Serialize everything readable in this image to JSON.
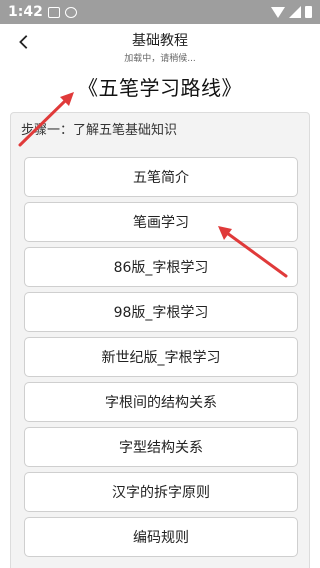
{
  "status_bar": {
    "time": "1:42",
    "icons": [
      "notification-icon",
      "sync-icon",
      "wifi-icon",
      "signal-icon",
      "battery-icon"
    ]
  },
  "nav": {
    "title": "基础教程",
    "subtitle": "加载中，请稍候..."
  },
  "main_title": "《五笔学习路线》",
  "step": {
    "label": "步骤一：了解五笔基础知识"
  },
  "topics": [
    "五笔简介",
    "笔画学习",
    "86版_字根学习",
    "98版_字根学习",
    "新世纪版_字根学习",
    "字根间的结构关系",
    "字型结构关系",
    "汉字的拆字原则",
    "编码规则"
  ],
  "colors": {
    "status_bar": "#9e9e9e",
    "card_bg": "#f3f3f3",
    "button_bg": "#ffffff",
    "arrow": "#e03a3a"
  }
}
